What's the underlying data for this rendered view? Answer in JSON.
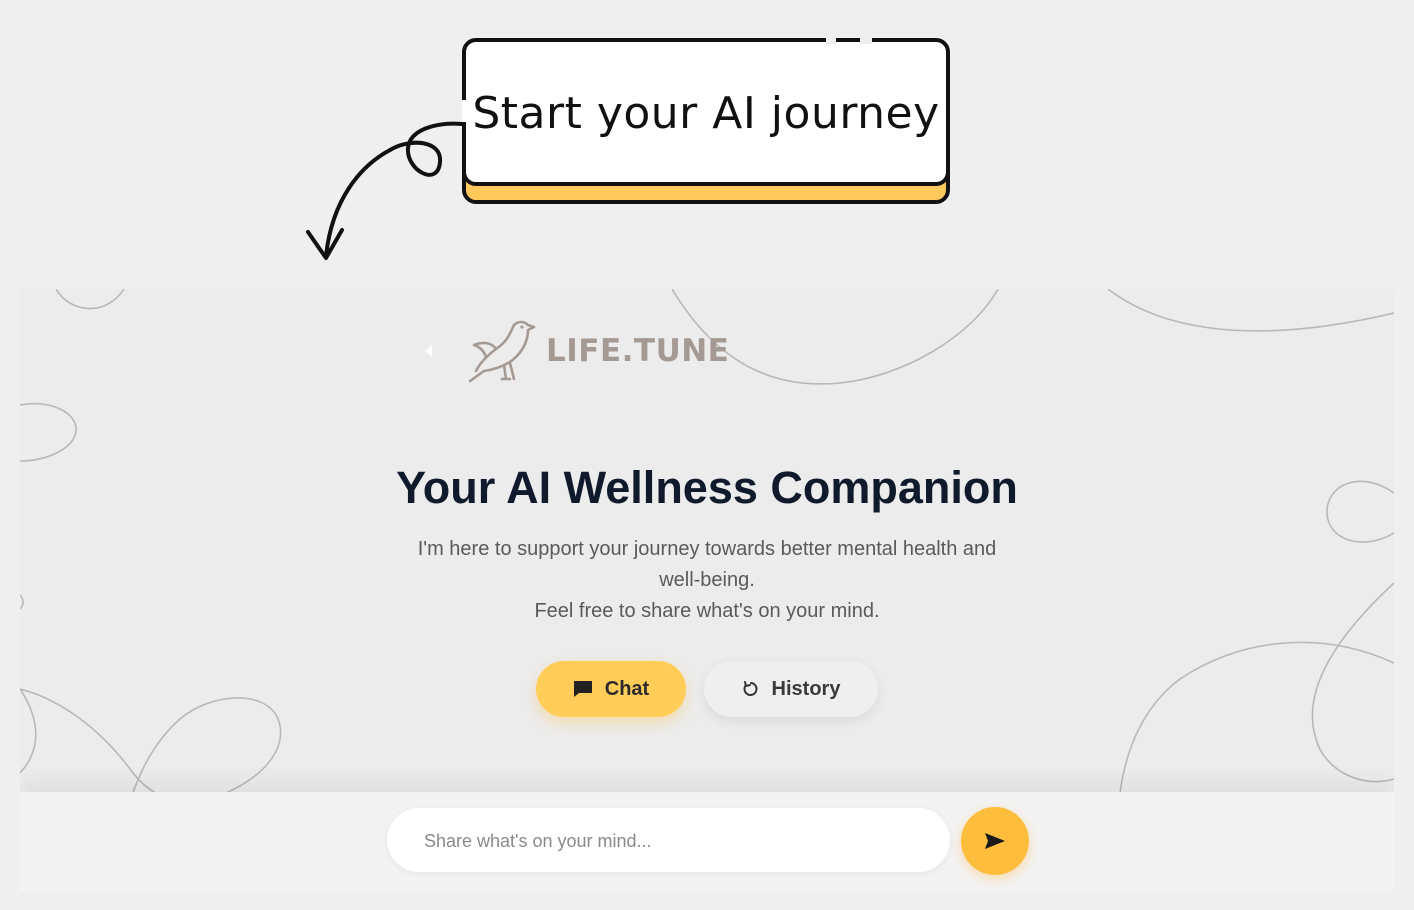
{
  "annotation": {
    "text": "Start your AI journey",
    "colors": {
      "fill": "#ffffff",
      "shadow": "#ffc85a",
      "border": "#111111"
    }
  },
  "brand": {
    "name": "LIFE.TUNE",
    "icon": "bird-icon",
    "color": "#a49a93"
  },
  "hero": {
    "title": "Your AI Wellness Companion",
    "subtitle_line1": "I'm here to support your journey towards better mental health and well-being.",
    "subtitle_line2": "Feel free to share what's on your mind."
  },
  "actions": {
    "chat_label": "Chat",
    "chat_icon": "message-icon",
    "history_label": "History",
    "history_icon": "refresh-icon"
  },
  "composer": {
    "placeholder": "Share what's on your mind...",
    "value": "",
    "send_icon": "send-icon"
  },
  "colors": {
    "accent": "#ffcd58",
    "send": "#ffbd3d",
    "title": "#0f1b2d",
    "background": "#ececec"
  }
}
